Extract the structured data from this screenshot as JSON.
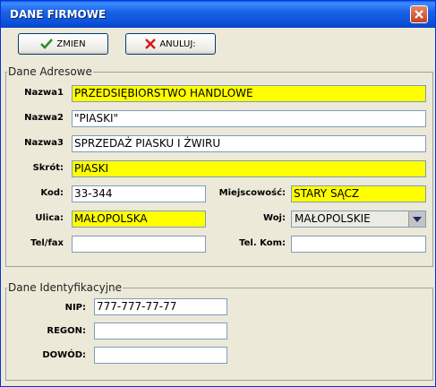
{
  "window": {
    "title": "DANE FIRMOWE"
  },
  "toolbar": {
    "save_label": "ZMIEN",
    "cancel_label": "ANULUJ:"
  },
  "address": {
    "legend": "Dane Adresowe",
    "nazwa1": {
      "label": "Nazwa1",
      "value": "PRZEDSIĘBIORSTWO HANDLOWE"
    },
    "nazwa2": {
      "label": "Nazwa2",
      "value": "\"PIASKI\""
    },
    "nazwa3": {
      "label": "Nazwa3",
      "value": "SPRZEDAŻ PIASKU I ŻWIRU"
    },
    "skrot": {
      "label": "Skrót:",
      "value": "PIASKI"
    },
    "kod": {
      "label": "Kod:",
      "value": "33-344"
    },
    "miejscowosc": {
      "label": "Miejscowość:",
      "value": "STARY SĄCZ"
    },
    "ulica": {
      "label": "Ulica:",
      "value": "MAŁOPOLSKA"
    },
    "woj": {
      "label": "Woj:",
      "value": "MAŁOPOLSKIE"
    },
    "telfax": {
      "label": "Tel/fax",
      "value": ""
    },
    "telkom": {
      "label": "Tel. Kom:",
      "value": ""
    }
  },
  "ident": {
    "legend": "Dane Identyfikacyjne",
    "nip": {
      "label": "NIP:",
      "value": "777-777-77-77"
    },
    "regon": {
      "label": "REGON:",
      "value": ""
    },
    "dowod": {
      "label": "DOWÓD:",
      "value": ""
    }
  },
  "colors": {
    "required_field": "#ffff00",
    "titlebar": "#0b4fd8"
  },
  "icons": {
    "save": "checkmark-icon",
    "cancel": "red-x-icon",
    "close": "close-icon",
    "dropdown": "chevron-down-icon"
  }
}
